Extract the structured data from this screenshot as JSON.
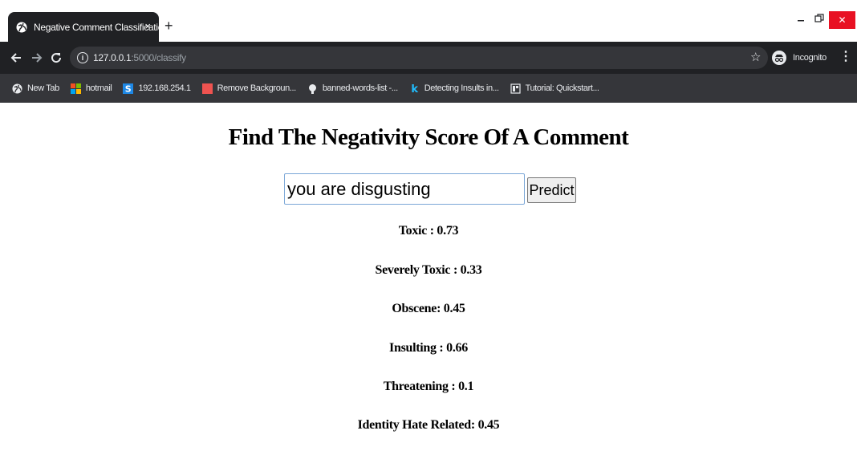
{
  "browser": {
    "tab_title": "Negative Comment Classification",
    "tab_close": "×",
    "new_tab": "+",
    "url_host": "127.0.0.1",
    "url_path": ":5000/classify",
    "incognito_label": "Incognito",
    "window_close": "✕"
  },
  "bookmarks": [
    {
      "label": "New Tab",
      "icon": "globe-icon"
    },
    {
      "label": "hotmail",
      "icon": "microsoft-icon"
    },
    {
      "label": "192.168.254.1",
      "icon": "s-icon"
    },
    {
      "label": "Remove Backgroun...",
      "icon": "remove-bg-icon"
    },
    {
      "label": "banned-words-list -...",
      "icon": "github-icon"
    },
    {
      "label": "Detecting Insults in...",
      "icon": "kaggle-icon"
    },
    {
      "label": "Tutorial: Quickstart...",
      "icon": "doc-icon"
    }
  ],
  "page": {
    "title": "Find The Negativity Score Of A Comment",
    "input_value": "you are disgusting",
    "predict_label": "Predict",
    "scores": [
      "Toxic : 0.73",
      "Severely Toxic : 0.33",
      "Obscene: 0.45",
      "Insulting : 0.66",
      "Threatening : 0.1",
      "Identity Hate Related: 0.45"
    ]
  },
  "colors": {
    "browser_dark": "#202124",
    "omnibox": "#35363a",
    "close_red": "#e81123",
    "input_border": "#7ba7d7"
  }
}
